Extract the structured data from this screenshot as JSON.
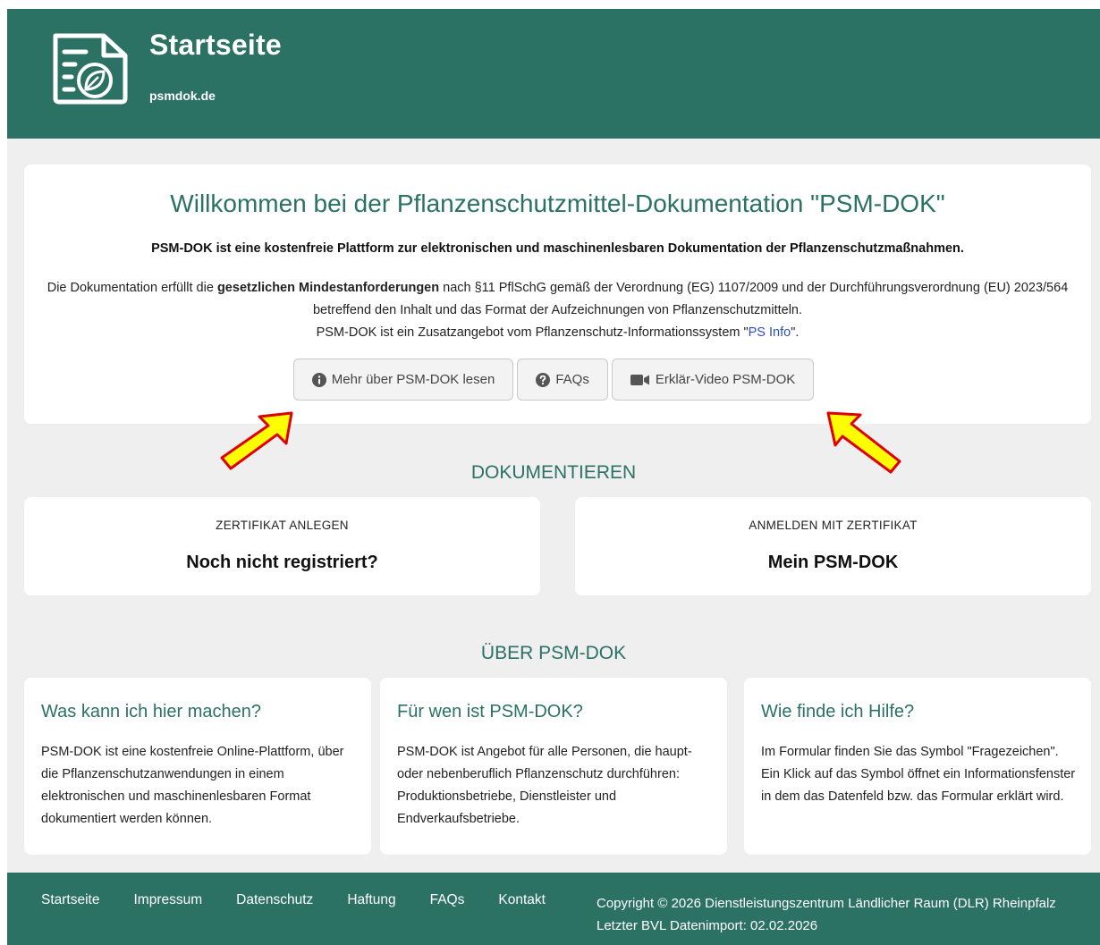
{
  "header": {
    "title": "Startseite",
    "subtitle": "psmdok.de",
    "logo_icon": "document-leaf-icon"
  },
  "welcome": {
    "heading": "Willkommen bei der Pflanzenschutzmittel-Dokumentation \"PSM-DOK\"",
    "lead": "PSM-DOK ist eine kostenfreie Plattform zur elektronischen und maschinenlesbaren Dokumentation der Pflanzenschutzmaßnahmen.",
    "desc_part1": "Die Dokumentation erfüllt die ",
    "desc_bold": "gesetzlichen Mindestanforderungen",
    "desc_part2": " nach §11 PflSchG gemäß der Verordnung (EG) 1107/2009 und der Durchführungsverordnung (EU) 2023/564 betreffend den Inhalt und das Format der Aufzeichnungen von Pflanzenschutzmitteln.",
    "desc_line3_pre": "PSM-DOK ist ein Zusatzangebot vom Pflanzenschutz-Informationssystem \"",
    "desc_link": "PS Info",
    "desc_line3_post": "\".",
    "buttons": [
      {
        "label": "Mehr über PSM-DOK lesen",
        "icon": "info-circle-icon"
      },
      {
        "label": "FAQs",
        "icon": "question-circle-icon"
      },
      {
        "label": "Erklär-Video PSM-DOK",
        "icon": "video-camera-icon"
      }
    ]
  },
  "dokumentieren": {
    "title": "DOKUMENTIEREN",
    "cards": [
      {
        "kicker": "ZERTIFIKAT ANLEGEN",
        "title": "Noch nicht registriert?"
      },
      {
        "kicker": "ANMELDEN MIT ZERTIFIKAT",
        "title": "Mein PSM-DOK"
      }
    ]
  },
  "ueber": {
    "title": "ÜBER PSM-DOK",
    "cards": [
      {
        "title": "Was kann ich hier machen?",
        "text": "PSM-DOK ist eine kostenfreie Online-Plattform, über die Pflanzenschutzanwendungen in einem elektronischen und maschinenlesbaren Format dokumentiert werden können."
      },
      {
        "title": "Für wen ist PSM-DOK?",
        "text": "PSM-DOK ist Angebot für alle Personen, die haupt- oder nebenberuflich Pflanzenschutz durchführen: Produktionsbetriebe, Dienstleister und Endverkaufsbetriebe."
      },
      {
        "title": "Wie finde ich Hilfe?",
        "text": "Im Formular finden Sie das Symbol \"Fragezeichen\". Ein Klick auf das Symbol öffnet ein Informationsfenster in dem das Datenfeld bzw. das Formular erklärt wird."
      }
    ]
  },
  "footer": {
    "links": [
      "Startseite",
      "Impressum",
      "Datenschutz",
      "Haftung",
      "FAQs",
      "Kontakt"
    ],
    "copyright": "Copyright © 2026 Dienstleistungszentrum Ländlicher Raum (DLR) Rheinpfalz",
    "import": "Letzter BVL Datenimport: 02.02.2026"
  },
  "colors": {
    "brand": "#2b7164",
    "background": "#efefef",
    "arrow_fill": "#ffff00",
    "arrow_stroke": "#e00000"
  }
}
